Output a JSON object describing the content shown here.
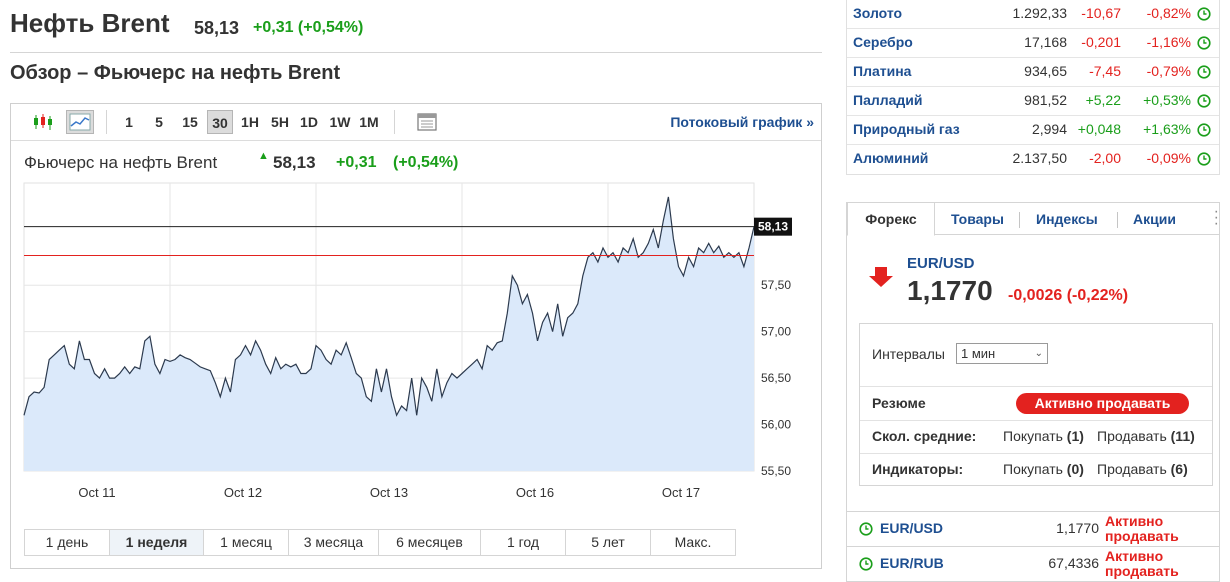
{
  "header": {
    "title": "Нефть Brent",
    "price": "58,13",
    "change": "+0,31 (+0,54%)",
    "subtitle": "Обзор – Фьючерс на нефть Brent"
  },
  "toolbar": {
    "intervals": [
      "1",
      "5",
      "15",
      "30",
      "1H",
      "5H",
      "1D",
      "1W",
      "1M"
    ],
    "selected": "30",
    "stream_link": "Потоковый график »"
  },
  "chart_header": {
    "name": "Фьючерс на нефть Brent",
    "price": "58,13",
    "change": "+0,31",
    "change_pct": "(+0,54%)"
  },
  "chart_data": {
    "type": "area",
    "x_ticks": [
      "Oct 11",
      "Oct 12",
      "Oct 13",
      "Oct 16",
      "Oct 17"
    ],
    "y_ticks": [
      "57,50",
      "57,00",
      "56,50",
      "56,00",
      "55,50"
    ],
    "ylim": [
      55.5,
      58.6
    ],
    "current_label": "58,13",
    "current_value": 58.13,
    "reference_value": 57.82,
    "values": [
      56.1,
      56.3,
      56.35,
      56.34,
      56.4,
      56.7,
      56.75,
      56.8,
      56.85,
      56.65,
      56.6,
      56.9,
      56.7,
      56.7,
      56.55,
      56.5,
      56.6,
      56.5,
      56.5,
      56.55,
      56.62,
      56.55,
      56.62,
      56.6,
      56.9,
      56.95,
      56.65,
      56.55,
      56.7,
      56.68,
      56.7,
      56.75,
      56.72,
      56.7,
      56.66,
      56.62,
      56.6,
      56.58,
      56.45,
      56.3,
      56.5,
      56.35,
      56.7,
      56.75,
      56.85,
      56.75,
      56.9,
      56.8,
      56.65,
      56.55,
      56.72,
      56.6,
      56.65,
      56.62,
      56.65,
      56.55,
      56.55,
      56.6,
      56.85,
      56.8,
      56.7,
      56.65,
      56.8,
      56.75,
      56.88,
      56.72,
      56.55,
      56.5,
      56.3,
      56.25,
      56.6,
      56.35,
      56.6,
      56.3,
      56.1,
      56.2,
      56.15,
      56.5,
      56.1,
      56.5,
      56.4,
      56.25,
      56.6,
      56.3,
      56.45,
      56.55,
      56.5,
      56.55,
      56.6,
      56.65,
      56.7,
      56.6,
      56.85,
      56.8,
      56.88,
      56.9,
      57.2,
      57.6,
      57.5,
      57.3,
      57.4,
      57.2,
      56.9,
      57.1,
      57.2,
      57.0,
      57.3,
      56.95,
      57.15,
      57.2,
      57.3,
      57.6,
      57.8,
      57.85,
      57.75,
      57.9,
      57.8,
      57.85,
      57.75,
      57.9,
      57.85,
      58.0,
      57.8,
      57.85,
      57.95,
      58.1,
      57.9,
      58.2,
      58.45,
      58.0,
      57.7,
      57.6,
      57.8,
      57.7,
      57.9,
      57.85,
      57.95,
      57.85,
      57.92,
      57.8,
      57.85,
      57.8,
      57.85,
      57.7,
      57.9,
      58.13
    ]
  },
  "periods": {
    "items": [
      "1 день",
      "1 неделя",
      "1 месяц",
      "3 месяца",
      "6 месяцев",
      "1 год",
      "5 лет",
      "Макс."
    ],
    "selected": "1 неделя"
  },
  "commodities": [
    {
      "name": "Золото",
      "value": "1.292,33",
      "change": "-10,67",
      "pct": "-0,82%"
    },
    {
      "name": "Серебро",
      "value": "17,168",
      "change": "-0,201",
      "pct": "-1,16%"
    },
    {
      "name": "Платина",
      "value": "934,65",
      "change": "-7,45",
      "pct": "-0,79%"
    },
    {
      "name": "Палладий",
      "value": "981,52",
      "change": "+5,22",
      "pct": "+0,53%"
    },
    {
      "name": "Природный газ",
      "value": "2,994",
      "change": "+0,048",
      "pct": "+1,63%"
    },
    {
      "name": "Алюминий",
      "value": "2.137,50",
      "change": "-2,00",
      "pct": "-0,09%"
    }
  ],
  "forex": {
    "tabs": [
      "Форекс",
      "Товары",
      "Индексы",
      "Акции"
    ],
    "selected_tab": "Форекс",
    "pair": "EUR/USD",
    "price": "1,1770",
    "change": "-0,0026 (-0,22%)",
    "interval_label": "Интервалы",
    "interval_value": "1 мин",
    "summary_label": "Резюме",
    "summary_value": "Активно продавать",
    "ma_label": "Скол. средние:",
    "ma_buy": "Покупать",
    "ma_buy_count": "(1)",
    "ma_sell": "Продавать",
    "ma_sell_count": "(11)",
    "ind_label": "Индикаторы:",
    "ind_buy": "Покупать",
    "ind_buy_count": "(0)",
    "ind_sell": "Продавать",
    "ind_sell_count": "(6)",
    "list": [
      {
        "pair": "EUR/USD",
        "value": "1,1770",
        "signal": "Активно продавать"
      },
      {
        "pair": "EUR/RUB",
        "value": "67,4336",
        "signal": "Активно продавать"
      }
    ]
  },
  "colors": {
    "up": "#1a9e1a",
    "down": "#e3221f",
    "link": "#1e4f91",
    "area_fill": "#dbe9fa",
    "line": "#2c3a4e"
  }
}
